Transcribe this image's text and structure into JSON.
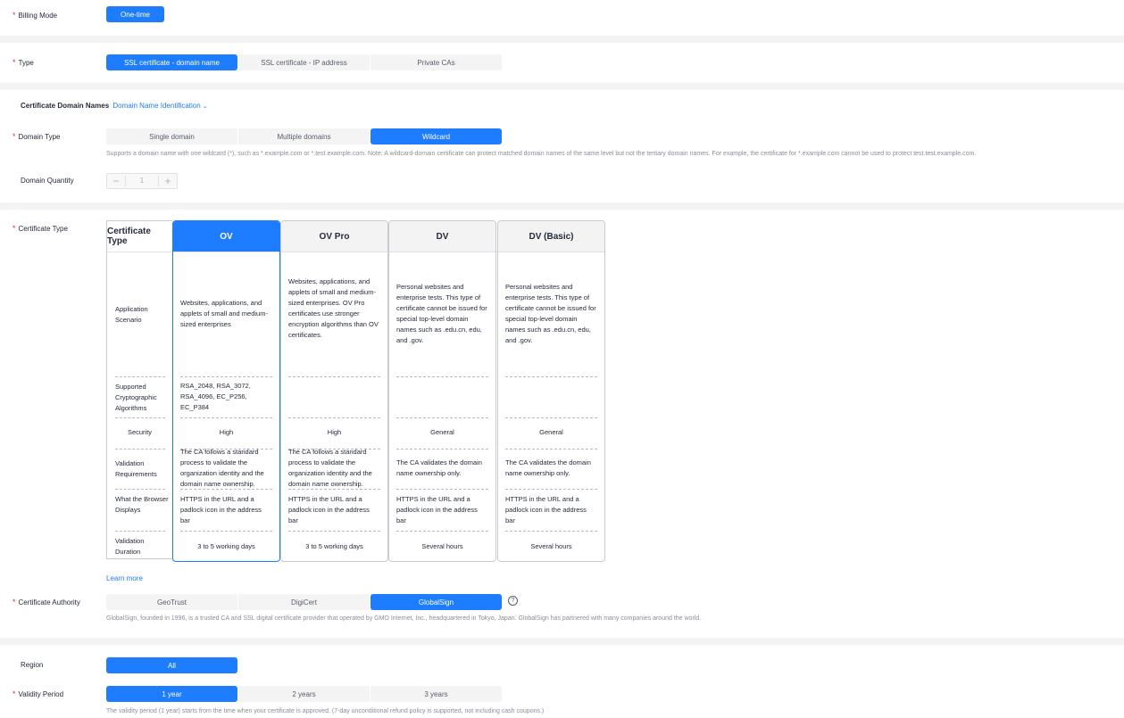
{
  "billing": {
    "label": "Billing Mode",
    "options": [
      "One-time"
    ]
  },
  "type": {
    "label": "Type",
    "options": [
      "SSL certificate - domain name",
      "SSL certificate - IP address",
      "Private CAs"
    ]
  },
  "domain_names": {
    "title": "Certificate Domain Names",
    "link": "Domain Name Identification"
  },
  "domain_type": {
    "label": "Domain Type",
    "options": [
      "Single domain",
      "Multiple domains",
      "Wildcard"
    ],
    "hint": "Supports a domain name with one wildcard (*), such as *.example.com or *.test.example.com. Note: A wildcard-domain certificate can protect matched domain names of the same level but not the tertiary domain names. For example, the certificate for *.example.com cannot be used to protect test.test.example.com."
  },
  "domain_quantity": {
    "label": "Domain Quantity",
    "value": "1",
    "minus": "−",
    "plus": "+"
  },
  "cert_type": {
    "label": "Certificate Type",
    "header": "Certificate Type",
    "row_labels": [
      "Application Scenario",
      "Supported Cryptographic Algorithms",
      "Security",
      "Validation Requirements",
      "What the Browser Displays",
      "Validation Duration"
    ],
    "columns": [
      {
        "name": "OV",
        "scenario": "Websites, applications, and applets of small and medium-sized enterprises",
        "algorithms": "RSA_2048, RSA_3072, RSA_4096, EC_P256, EC_P384",
        "security": "High",
        "validation": "The CA follows a standard process to validate the organization identity and the domain name ownership.",
        "browser": "HTTPS in the URL and a padlock icon in the address bar",
        "duration": "3 to 5 working days"
      },
      {
        "name": "OV Pro",
        "scenario": "Websites, applications, and applets of small and medium-sized enterprises. OV Pro certificates use stronger encryption algorithms than OV certificates.",
        "algorithms": "",
        "security": "High",
        "validation": "The CA follows a standard process to validate the organization identity and the domain name ownership.",
        "browser": "HTTPS in the URL and a padlock icon in the address bar",
        "duration": "3 to 5 working days"
      },
      {
        "name": "DV",
        "scenario": "Personal websites and enterprise tests. This type of certificate cannot be issued for special top-level domain names such as .edu.cn, edu, and .gov.",
        "algorithms": "",
        "security": "General",
        "validation": "The CA validates the domain name ownership only.",
        "browser": "HTTPS in the URL and a padlock icon in the address bar",
        "duration": "Several hours"
      },
      {
        "name": "DV (Basic)",
        "scenario": "Personal websites and enterprise tests. This type of certificate cannot be issued for special top-level domain names such as .edu.cn, edu, and .gov.",
        "algorithms": "",
        "security": "General",
        "validation": "The CA validates the domain name ownership only.",
        "browser": "HTTPS in the URL and a padlock icon in the address bar",
        "duration": "Several hours"
      }
    ],
    "learn_more": "Learn more"
  },
  "authority": {
    "label": "Certificate Authority",
    "options": [
      "GeoTrust",
      "DigiCert",
      "GlobalSign"
    ],
    "help": "?",
    "hint": "GlobalSign, founded in 1996, is a trusted CA and SSL digital certificate provider that operated by GMO Internet, Inc., headquartered in Tokyo, Japan. GlobalSign has partnered with many companies around the world."
  },
  "region": {
    "label": "Region",
    "options": [
      "All"
    ]
  },
  "validity": {
    "label": "Validity Period",
    "options": [
      "1 year",
      "2 years",
      "3 years"
    ],
    "hint": "The validity period (1 year) starts from the time when your certificate is approved. (7-day unconditional refund policy is supported, not including cash coupons.)"
  },
  "colors": {
    "accent": "#1e7cff",
    "required": "#e5342b"
  }
}
